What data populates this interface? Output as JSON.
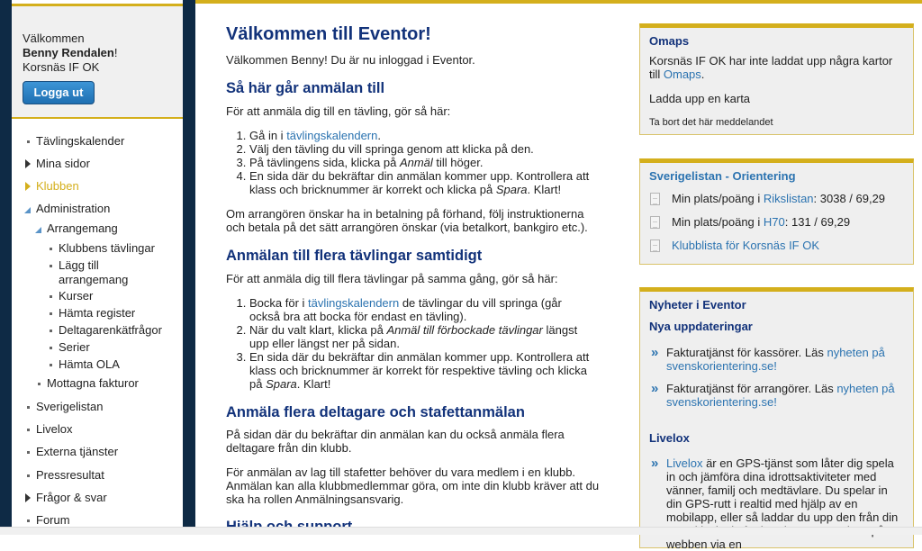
{
  "sidebar": {
    "welcome": "Välkommen",
    "user_name": "Benny Rendalen",
    "exclaim": "!",
    "club": "Korsnäs IF OK",
    "logout_label": "Logga ut",
    "nav": [
      {
        "label": "Tävlingskalender",
        "type": "bullet",
        "level": 0
      },
      {
        "label": "Mina sidor",
        "type": "collapsed",
        "level": 0
      },
      {
        "label": "Klubben",
        "type": "collapsed-active",
        "level": 0
      },
      {
        "label": "Administration",
        "type": "expanded",
        "level": 0
      },
      {
        "label": "Arrangemang",
        "type": "expanded",
        "level": 1
      },
      {
        "label": "Klubbens tävlingar",
        "type": "bullet",
        "level": 2
      },
      {
        "label": "Lägg till arrangemang",
        "type": "bullet",
        "level": 2
      },
      {
        "label": "Kurser",
        "type": "bullet",
        "level": 2
      },
      {
        "label": "Hämta register",
        "type": "bullet",
        "level": 2
      },
      {
        "label": "Deltagarenkätfrågor",
        "type": "bullet",
        "level": 2
      },
      {
        "label": "Serier",
        "type": "bullet",
        "level": 2
      },
      {
        "label": "Hämta OLA",
        "type": "bullet",
        "level": 2
      },
      {
        "label": "Mottagna fakturor",
        "type": "bullet",
        "level": 1
      },
      {
        "label": "Sverigelistan",
        "type": "bullet",
        "level": 0
      },
      {
        "label": "Livelox",
        "type": "bullet",
        "level": 0
      },
      {
        "label": "Externa tjänster",
        "type": "bullet",
        "level": 0
      },
      {
        "label": "Pressresultat",
        "type": "bullet",
        "level": 0
      },
      {
        "label": "Frågor & svar",
        "type": "collapsed",
        "level": 0
      },
      {
        "label": "Forum",
        "type": "bullet",
        "level": 0
      }
    ]
  },
  "main": {
    "title": "Välkommen till Eventor!",
    "intro": "Välkommen Benny! Du är nu inloggad i Eventor.",
    "section1": {
      "heading": "Så här går anmälan till",
      "lead": "För att anmäla dig till en tävling, gör så här:",
      "steps": [
        {
          "pre": "Gå in i ",
          "link": "tävlingskalendern",
          "post": "."
        },
        {
          "text": "Välj den tävling du vill springa genom att klicka på den."
        },
        {
          "pre": "På tävlingens sida, klicka på ",
          "em": "Anmäl",
          "post": " till höger."
        },
        {
          "pre": "En sida där du bekräftar din anmälan kommer upp. Kontrollera att klass och bricknummer är korrekt och klicka på ",
          "em": "Spara",
          "post": ". Klart!"
        }
      ],
      "payment": "Om arrangören önskar ha in betalning på förhand, följ instruktionerna och betala på det sätt arrangören önskar (via betalkort, bankgiro etc.)."
    },
    "section2": {
      "heading": "Anmälan till flera tävlingar samtidigt",
      "lead": "För att anmäla dig till flera tävlingar på samma gång, gör så här:",
      "steps": [
        {
          "pre": "Bocka för i ",
          "link": "tävlingskalendern",
          "post": " de tävlingar du vill springa (går också bra att bocka för endast en tävling)."
        },
        {
          "pre": "När du valt klart, klicka på ",
          "em": "Anmäl till förbockade tävlingar",
          "post": " längst upp eller längst ner på sidan."
        },
        {
          "pre": "En sida där du bekräftar din anmälan kommer upp. Kontrollera att klass och bricknummer är korrekt för respektive tävling och klicka på ",
          "em": "Spara",
          "post": ". Klart!"
        }
      ]
    },
    "section3": {
      "heading": "Anmäla flera deltagare och stafettanmälan",
      "p1": "På sidan där du bekräftar din anmälan kan du också anmäla flera deltagare från din klubb.",
      "p2": "För anmälan av lag till stafetter behöver du vara medlem i en klubb. Anmälan kan alla klubbmedlemmar göra, om inte din klubb kräver att du ska ha rollen Anmälningsansvarig."
    },
    "section4": {
      "heading": "Hjälp och support"
    }
  },
  "right": {
    "omaps": {
      "title": "Omaps",
      "text": "Korsnäs IF OK har inte laddat upp några kartor till ",
      "link": "Omaps",
      "post": ".",
      "upload": "Ladda upp en karta",
      "remove": "Ta bort det här meddelandet"
    },
    "sverigelistan": {
      "title": "Sverigelistan - Orientering",
      "rows": [
        {
          "pre": "Min plats/poäng i ",
          "link": "Rikslistan",
          "post": ": 3038 / 69,29"
        },
        {
          "pre": "Min plats/poäng i ",
          "link": "H70",
          "post": ": 131 / 69,29"
        },
        {
          "pre": "",
          "link": "Klubblista för Korsnäs IF OK",
          "post": ""
        }
      ]
    },
    "news": {
      "title": "Nyheter i Eventor",
      "subtitle": "Nya uppdateringar",
      "items": [
        {
          "pre": "Fakturatjänst för kassörer. Läs ",
          "link": "nyheten på svenskorientering.se!"
        },
        {
          "pre": "Fakturatjänst för arrangörer. Läs ",
          "link": "nyheten på svenskorientering.se!"
        }
      ],
      "livelox_title": "Livelox",
      "livelox_link": "Livelox",
      "livelox_text": " är en GPS-tjänst som låter dig spela in och jämföra dina idrottsaktiviteter med vänner, familj och medtävlare. Du spelar in din GPS-rutt i realtid med hjälp av en mobilapp, eller så laddar du upp den från din GPS-klocka i efterhand. Rutterna visas på webben via en"
    }
  }
}
